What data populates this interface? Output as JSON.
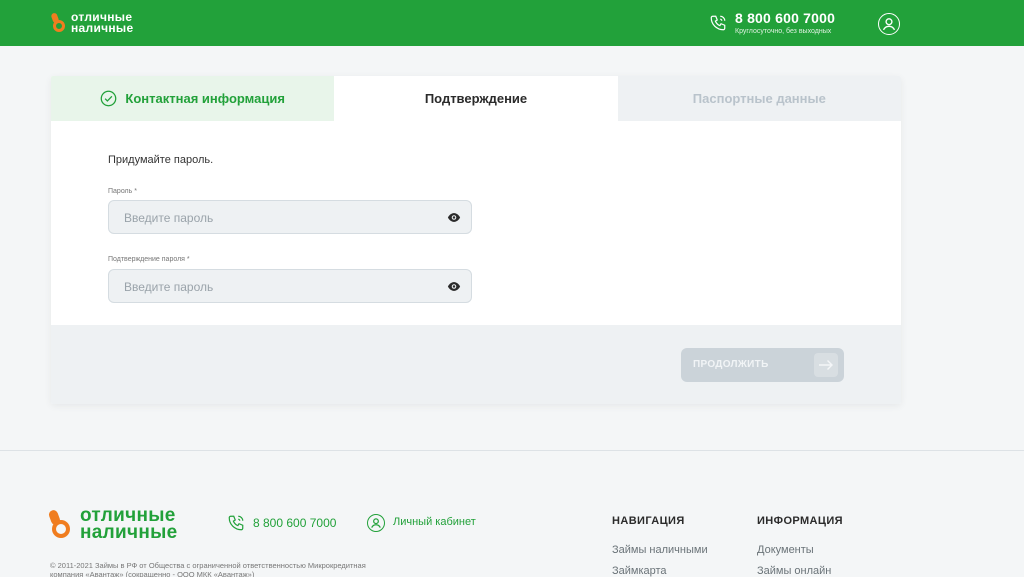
{
  "header": {
    "logo_line1": "отличные",
    "logo_line2": "наличные",
    "phone": "8 800 600 7000",
    "phone_note": "Круглосуточно, без выходных"
  },
  "steps": {
    "tab1": "Контактная информация",
    "tab2": "Подтверждение",
    "tab3": "Паспортные данные"
  },
  "form": {
    "hint": "Придумайте пароль.",
    "password_label": "Пароль *",
    "password_placeholder": "Введите пароль",
    "confirm_label": "Подтверждение пароля *",
    "confirm_placeholder": "Введите пароль",
    "continue_label": "ПРОДОЛЖИТЬ"
  },
  "footer": {
    "logo_line1": "отличные",
    "logo_line2": "наличные",
    "phone": "8 800 600 7000",
    "cabinet": "Личный кабинет",
    "copyright": "© 2011-2021 Займы в РФ от Общества с ограниченной ответственностью Микрокредитная компания «Авантаж» (сокращенно - ООО МКК «Авантаж»)",
    "nav_title": "НАВИГАЦИЯ",
    "nav_links": [
      "Займы наличными",
      "Займкарта"
    ],
    "info_title": "ИНФОРМАЦИЯ",
    "info_links": [
      "Документы",
      "Займы онлайн"
    ]
  },
  "colors": {
    "brand_green": "#22a13a",
    "brand_orange": "#f07d1f",
    "disabled_button": "#cbd3d9"
  },
  "icons": [
    "phone-icon",
    "user-icon",
    "check-circle-icon",
    "eye-icon",
    "arrow-right-icon"
  ]
}
